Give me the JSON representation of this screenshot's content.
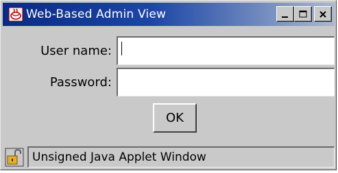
{
  "window": {
    "title": "Web-Based Admin View",
    "buttons": {
      "minimize": "minimize",
      "maximize": "maximize",
      "close": "close"
    }
  },
  "form": {
    "username_label": "User name:",
    "username_value": "",
    "password_label": "Password:",
    "password_value": "",
    "ok_label": "OK"
  },
  "status": {
    "text": "Unsigned Java Applet Window",
    "icon": "unlocked-padlock-icon"
  },
  "colors": {
    "titlebar_start": "#0a2a86",
    "titlebar_end": "#aab8d0",
    "window_bg": "#c9c9c9"
  }
}
